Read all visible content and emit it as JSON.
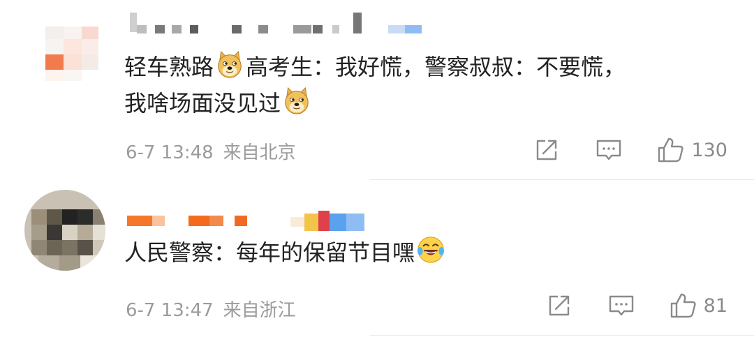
{
  "comments": [
    {
      "text_parts": [
        "轻车熟路",
        "高考生：我好慌，警察叔叔：不要慌，",
        "我啥场面没见过"
      ],
      "time": "6-7 13:48",
      "location": "来自北京",
      "likes": "130"
    },
    {
      "text_parts": [
        "人民警察：每年的保留节目嘿"
      ],
      "time": "6-7 13:47",
      "location": "来自浙江",
      "likes": "81"
    }
  ],
  "icons": {
    "doge_emoji": "doge-emoji-icon",
    "laugh_cry_emoji": "laugh-cry-emoji-icon",
    "share": "share-icon",
    "reply": "comment-icon",
    "like": "thumb-up-icon"
  },
  "colors": {
    "text": "#222222",
    "meta": "#9b9b9b",
    "icon": "#8a8a8a",
    "divider": "#e8e8e8",
    "username_accent": "#f5782a",
    "badge_blue": "#8fbdf3"
  }
}
